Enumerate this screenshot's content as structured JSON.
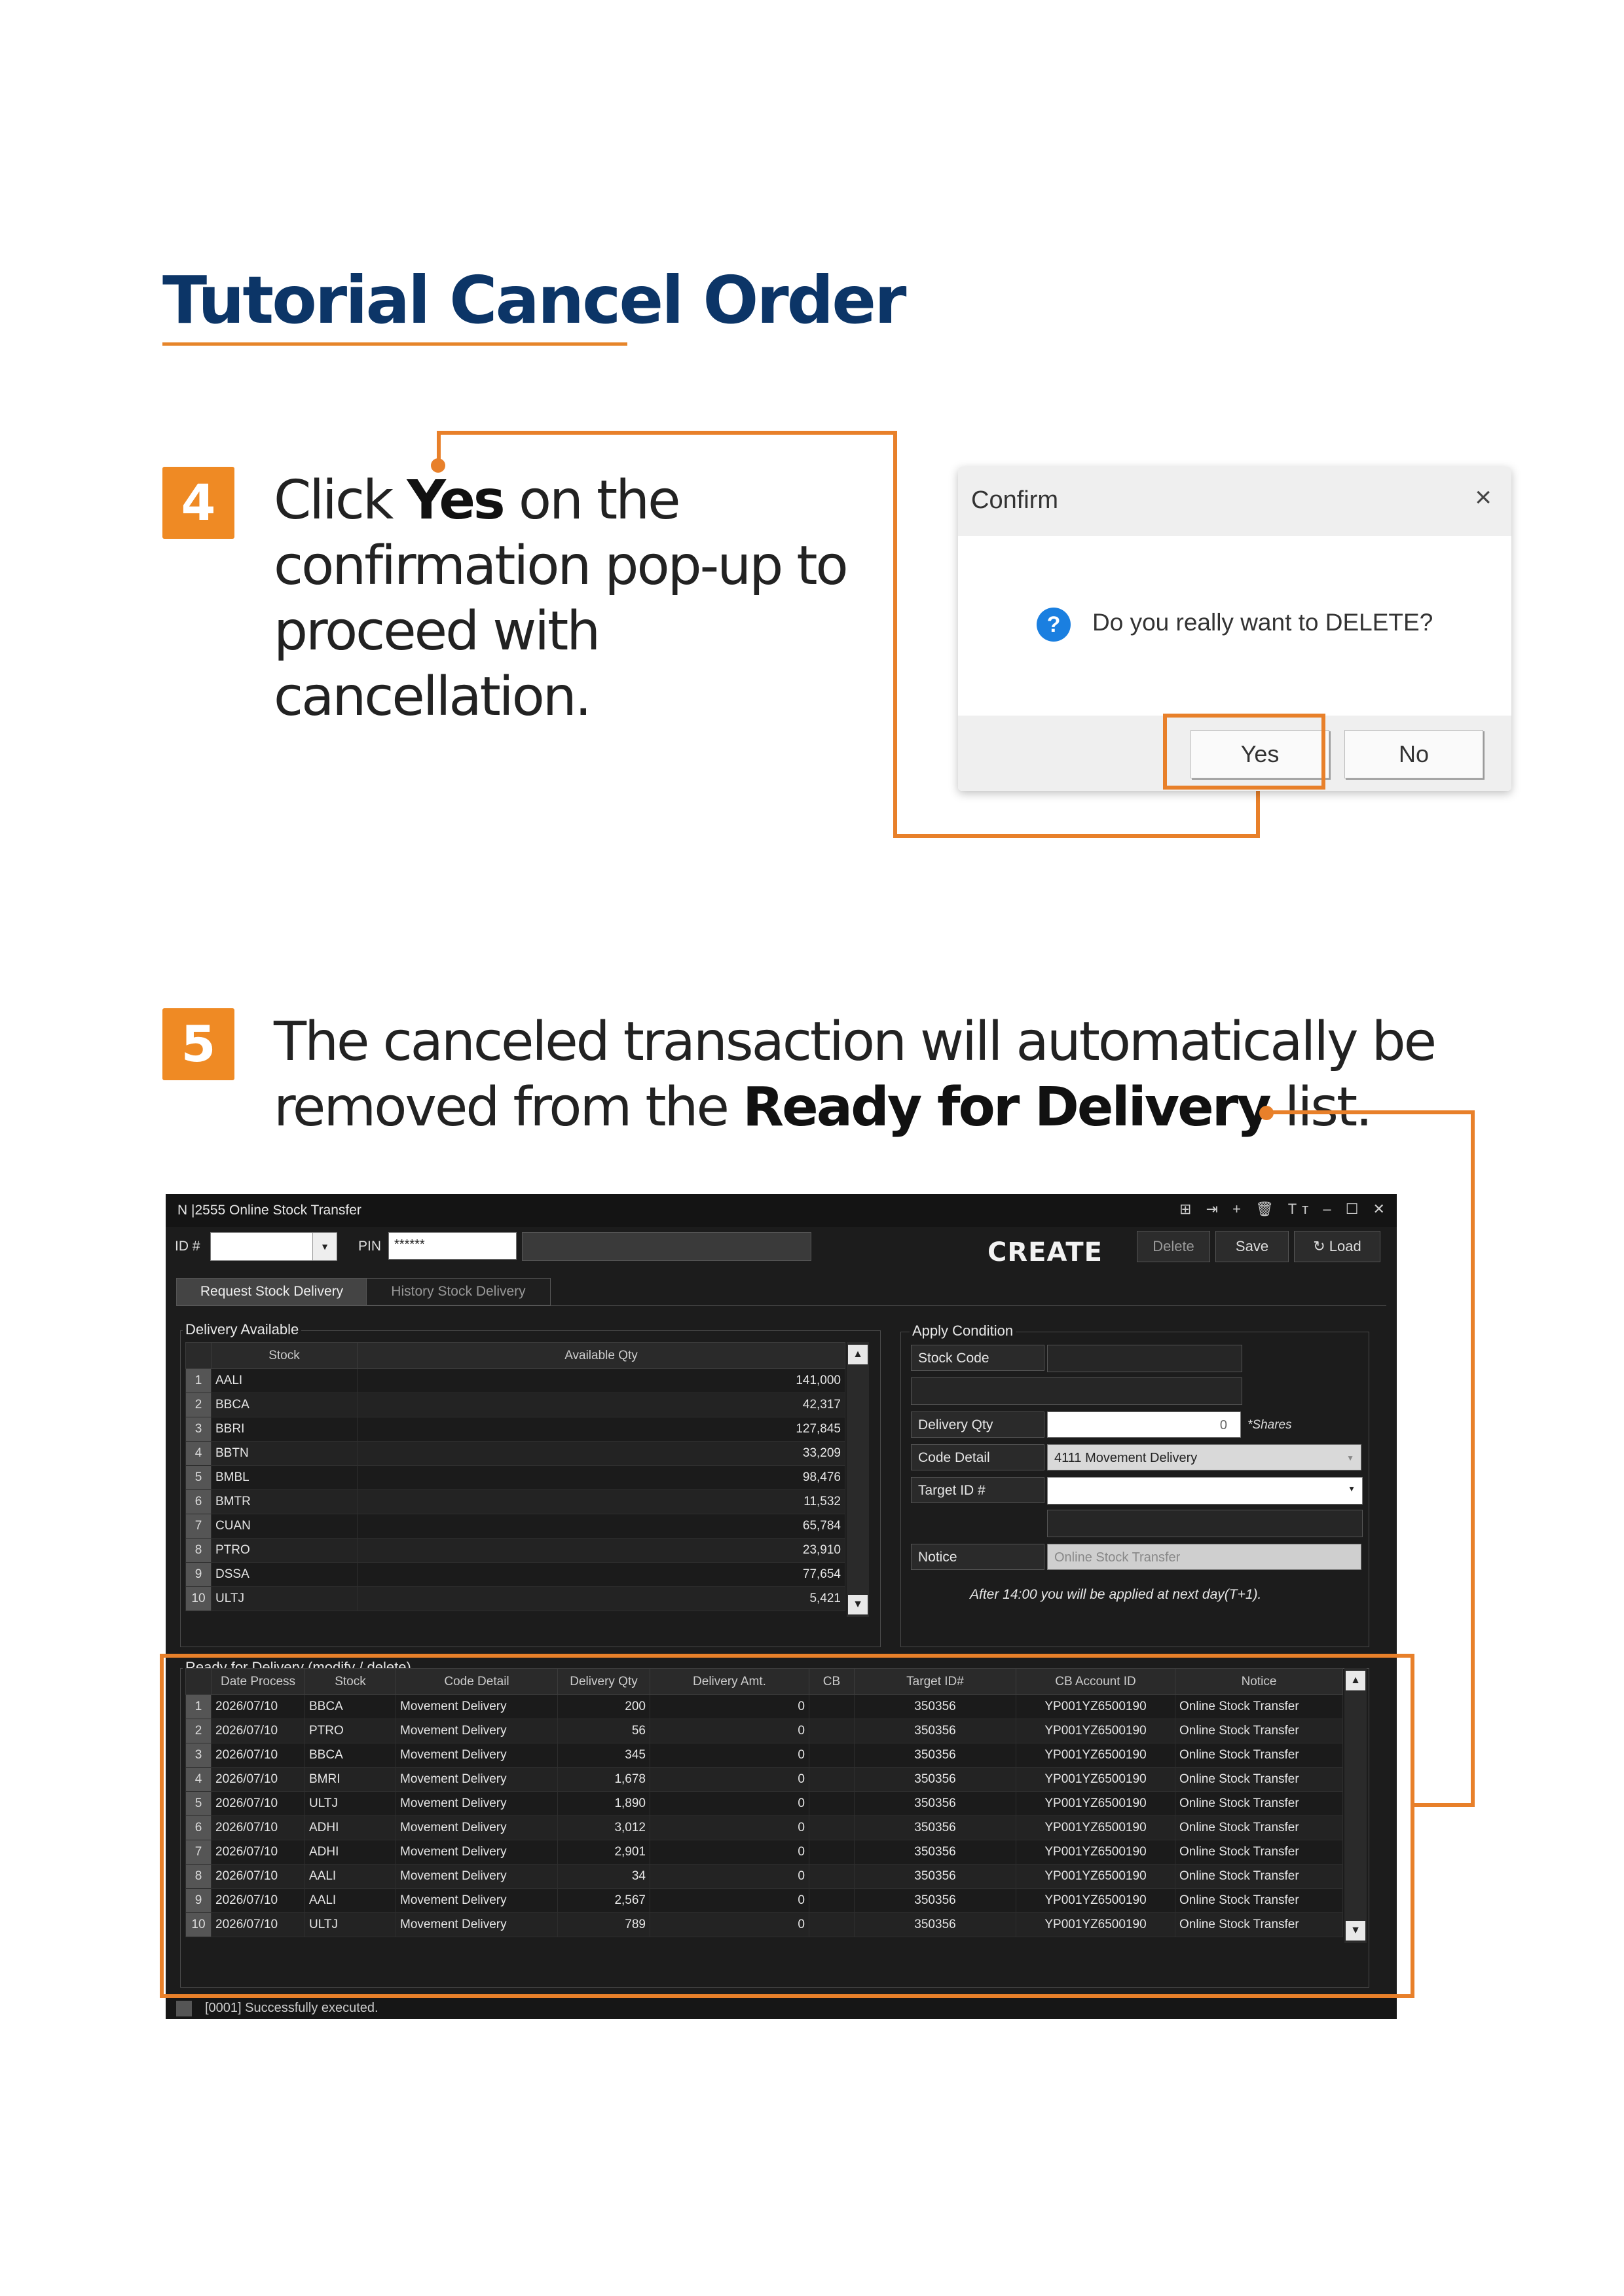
{
  "title": "Tutorial Cancel Order",
  "step4": {
    "number": "4",
    "text_before": "Click ",
    "bold": "Yes",
    "text_line1_after": " on the",
    "line2": "confirmation pop-up to",
    "line3": "proceed with",
    "line4": "cancellation."
  },
  "dialog": {
    "title": "Confirm",
    "close": "×",
    "icon": "?",
    "message": "Do you really want to DELETE?",
    "yes": "Yes",
    "no": "No"
  },
  "step5": {
    "number": "5",
    "line1": "The canceled transaction will automatically be",
    "line2_before": "removed from the ",
    "bold": "Ready for Delivery",
    "line2_after": " list."
  },
  "app": {
    "window_title": "N |2555 Online Stock Transfer",
    "window_icons": "⊞ ⇥ + 🗑 Tт – ☐ ✕",
    "id_label": "ID #",
    "pin_label": "PIN",
    "pin_value": "******",
    "mode": "CREATE",
    "btn_delete": "Delete",
    "btn_save": "Save",
    "btn_load": "Load",
    "tab_request": "Request Stock Delivery",
    "tab_history": "History Stock Delivery",
    "available": {
      "title": "Delivery Available",
      "headers": [
        "Stock",
        "Available Qty"
      ],
      "rows": [
        [
          "1",
          "AALI",
          "141,000"
        ],
        [
          "2",
          "BBCA",
          "42,317"
        ],
        [
          "3",
          "BBRI",
          "127,845"
        ],
        [
          "4",
          "BBTN",
          "33,209"
        ],
        [
          "5",
          "BMBL",
          "98,476"
        ],
        [
          "6",
          "BMTR",
          "11,532"
        ],
        [
          "7",
          "CUAN",
          "65,784"
        ],
        [
          "8",
          "PTRO",
          "23,910"
        ],
        [
          "9",
          "DSSA",
          "77,654"
        ],
        [
          "10",
          "ULTJ",
          "5,421"
        ]
      ]
    },
    "apply": {
      "title": "Apply Condition",
      "stock_code": "Stock Code",
      "delivery_qty": "Delivery Qty",
      "delivery_qty_value": "0",
      "shares": "*Shares",
      "code_detail": "Code Detail",
      "code_detail_value": "4111 Movement Delivery",
      "target_id": "Target ID #",
      "notice": "Notice",
      "notice_value": "Online Stock Transfer",
      "note": "After 14:00 you will be applied at next day(T+1)."
    },
    "ready": {
      "title": "Ready for Delivery (modify / delete)",
      "headers": [
        "Date Process",
        "Stock",
        "Code Detail",
        "Delivery Qty",
        "Delivery Amt.",
        "CB",
        "Target ID#",
        "CB Account ID",
        "Notice"
      ],
      "rows": [
        [
          "1",
          "2026/07/10",
          "BBCA",
          "Movement Delivery",
          "200",
          "0",
          "",
          "350356",
          "YP001YZ6500190",
          "Online Stock Transfer"
        ],
        [
          "2",
          "2026/07/10",
          "PTRO",
          "Movement Delivery",
          "56",
          "0",
          "",
          "350356",
          "YP001YZ6500190",
          "Online Stock Transfer"
        ],
        [
          "3",
          "2026/07/10",
          "BBCA",
          "Movement Delivery",
          "345",
          "0",
          "",
          "350356",
          "YP001YZ6500190",
          "Online Stock Transfer"
        ],
        [
          "4",
          "2026/07/10",
          "BMRI",
          "Movement Delivery",
          "1,678",
          "0",
          "",
          "350356",
          "YP001YZ6500190",
          "Online Stock Transfer"
        ],
        [
          "5",
          "2026/07/10",
          "ULTJ",
          "Movement Delivery",
          "1,890",
          "0",
          "",
          "350356",
          "YP001YZ6500190",
          "Online Stock Transfer"
        ],
        [
          "6",
          "2026/07/10",
          "ADHI",
          "Movement Delivery",
          "3,012",
          "0",
          "",
          "350356",
          "YP001YZ6500190",
          "Online Stock Transfer"
        ],
        [
          "7",
          "2026/07/10",
          "ADHI",
          "Movement Delivery",
          "2,901",
          "0",
          "",
          "350356",
          "YP001YZ6500190",
          "Online Stock Transfer"
        ],
        [
          "8",
          "2026/07/10",
          "AALI",
          "Movement Delivery",
          "34",
          "0",
          "",
          "350356",
          "YP001YZ6500190",
          "Online Stock Transfer"
        ],
        [
          "9",
          "2026/07/10",
          "AALI",
          "Movement Delivery",
          "2,567",
          "0",
          "",
          "350356",
          "YP001YZ6500190",
          "Online Stock Transfer"
        ],
        [
          "10",
          "2026/07/10",
          "ULTJ",
          "Movement Delivery",
          "789",
          "0",
          "",
          "350356",
          "YP001YZ6500190",
          "Online Stock Transfer"
        ]
      ]
    },
    "status": "[0001] Successfully executed."
  },
  "colors": {
    "title": "#0c3567",
    "accent": "#ef8a24",
    "question_icon": "#1a7fe0"
  }
}
